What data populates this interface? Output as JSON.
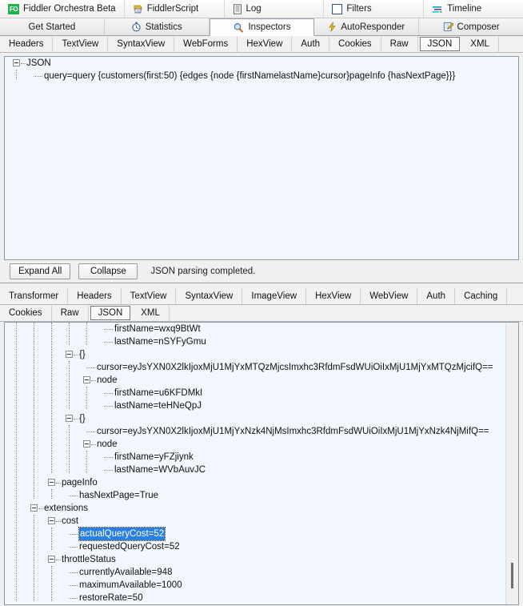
{
  "ribbon": {
    "buttons": [
      {
        "label": "Fiddler Orchestra Beta",
        "icon": "fo-badge-icon"
      },
      {
        "label": "FiddlerScript",
        "icon": "script-js-icon"
      },
      {
        "label": "Log",
        "icon": "log-list-icon"
      },
      {
        "label": "Filters",
        "icon": "filters-checkbox-icon"
      },
      {
        "label": "Timeline",
        "icon": "timeline-bars-icon"
      }
    ]
  },
  "main_tabs": [
    {
      "label": "Get Started",
      "icon": "",
      "active": false
    },
    {
      "label": "Statistics",
      "icon": "stopwatch-icon",
      "active": false
    },
    {
      "label": "Inspectors",
      "icon": "magnifier-icon",
      "active": true
    },
    {
      "label": "AutoResponder",
      "icon": "lightning-icon",
      "active": false
    },
    {
      "label": "Composer",
      "icon": "pencil-note-icon",
      "active": false
    }
  ],
  "request_subtabs": [
    {
      "label": "Headers",
      "selected": false
    },
    {
      "label": "TextView",
      "selected": false
    },
    {
      "label": "SyntaxView",
      "selected": false
    },
    {
      "label": "WebForms",
      "selected": false
    },
    {
      "label": "HexView",
      "selected": false
    },
    {
      "label": "Auth",
      "selected": false
    },
    {
      "label": "Cookies",
      "selected": false
    },
    {
      "label": "Raw",
      "selected": false
    },
    {
      "label": "JSON",
      "selected": true
    },
    {
      "label": "XML",
      "selected": false
    }
  ],
  "response_subtabs_row1": [
    {
      "label": "Transformer",
      "selected": false
    },
    {
      "label": "Headers",
      "selected": false
    },
    {
      "label": "TextView",
      "selected": false
    },
    {
      "label": "SyntaxView",
      "selected": false
    },
    {
      "label": "ImageView",
      "selected": false
    },
    {
      "label": "HexView",
      "selected": false
    },
    {
      "label": "WebView",
      "selected": false
    },
    {
      "label": "Auth",
      "selected": false
    },
    {
      "label": "Caching",
      "selected": false
    }
  ],
  "response_subtabs_row2": [
    {
      "label": "Cookies",
      "selected": false
    },
    {
      "label": "Raw",
      "selected": false
    },
    {
      "label": "JSON",
      "selected": true
    },
    {
      "label": "XML",
      "selected": false
    }
  ],
  "request_tree": [
    {
      "text": "JSON",
      "depth": 0,
      "expander": true,
      "stub": true,
      "highlight": false
    },
    {
      "text": "query=query {customers(first:50) {edges {node {firstNamelastName}cursor}pageInfo {hasNextPage}}}",
      "depth": 1,
      "expander": false,
      "stub": true,
      "highlight": false
    }
  ],
  "response_tree": [
    {
      "text": "firstName=wxq9BtWt",
      "depth": 5,
      "expander": false,
      "stub": true,
      "highlight": false
    },
    {
      "text": "lastName=nSYFyGmu",
      "depth": 5,
      "expander": false,
      "stub": true,
      "highlight": false
    },
    {
      "text": "{}",
      "depth": 3,
      "expander": true,
      "stub": true,
      "highlight": false
    },
    {
      "text": "cursor=eyJsYXN0X2lkIjoxMjU1MjYxMTQzMjcsImxhc3RfdmFsdWUiOiIxMjU1MjYxMTQzMjcifQ==",
      "depth": 4,
      "expander": false,
      "stub": true,
      "highlight": false
    },
    {
      "text": "node",
      "depth": 4,
      "expander": true,
      "stub": true,
      "highlight": false
    },
    {
      "text": "firstName=u6KFDMkI",
      "depth": 5,
      "expander": false,
      "stub": true,
      "highlight": false
    },
    {
      "text": "lastName=teHNeQpJ",
      "depth": 5,
      "expander": false,
      "stub": true,
      "highlight": false
    },
    {
      "text": "{}",
      "depth": 3,
      "expander": true,
      "stub": true,
      "highlight": false
    },
    {
      "text": "cursor=eyJsYXN0X2lkIjoxMjU1MjYxNzk4NjMsImxhc3RfdmFsdWUiOiIxMjU1MjYxNzk4NjMifQ==",
      "depth": 4,
      "expander": false,
      "stub": true,
      "highlight": false
    },
    {
      "text": "node",
      "depth": 4,
      "expander": true,
      "stub": true,
      "highlight": false
    },
    {
      "text": "firstName=yFZjiynk",
      "depth": 5,
      "expander": false,
      "stub": true,
      "highlight": false
    },
    {
      "text": "lastName=WVbAuvJC",
      "depth": 5,
      "expander": false,
      "stub": true,
      "highlight": false
    },
    {
      "text": "pageInfo",
      "depth": 2,
      "expander": true,
      "stub": true,
      "highlight": false
    },
    {
      "text": "hasNextPage=True",
      "depth": 3,
      "expander": false,
      "stub": true,
      "highlight": false
    },
    {
      "text": "extensions",
      "depth": 1,
      "expander": true,
      "stub": true,
      "highlight": false
    },
    {
      "text": "cost",
      "depth": 2,
      "expander": true,
      "stub": true,
      "highlight": false
    },
    {
      "text": "actualQueryCost=52",
      "depth": 3,
      "expander": false,
      "stub": true,
      "highlight": true
    },
    {
      "text": "requestedQueryCost=52",
      "depth": 3,
      "expander": false,
      "stub": true,
      "highlight": false
    },
    {
      "text": "throttleStatus",
      "depth": 2,
      "expander": true,
      "stub": true,
      "highlight": false
    },
    {
      "text": "currentlyAvailable=948",
      "depth": 3,
      "expander": false,
      "stub": true,
      "highlight": false
    },
    {
      "text": "maximumAvailable=1000",
      "depth": 3,
      "expander": false,
      "stub": true,
      "highlight": false
    },
    {
      "text": "restoreRate=50",
      "depth": 3,
      "expander": false,
      "stub": true,
      "highlight": false
    }
  ],
  "action_bar": {
    "expand_all_label": "Expand All",
    "collapse_label": "Collapse",
    "status": "JSON parsing completed."
  },
  "colors": {
    "tree_background": "#f2f7fd",
    "selection": "#2b7fe0",
    "panel_border": "#8a9aa8",
    "chrome": "#f0f0f0",
    "orchestra_badge": "#21b24b"
  }
}
